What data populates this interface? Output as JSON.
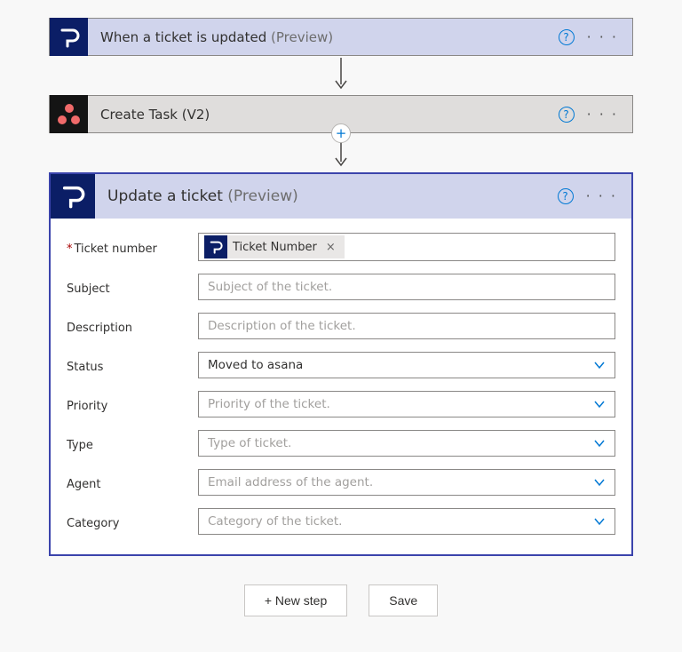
{
  "steps": {
    "trigger": {
      "title": "When a ticket is updated",
      "preview": "(Preview)"
    },
    "action1": {
      "title": "Create Task (V2)"
    },
    "selected": {
      "title": "Update a ticket",
      "preview": "(Preview)"
    }
  },
  "token": {
    "label": "Ticket Number"
  },
  "fields": {
    "ticket_number": {
      "label": "Ticket number"
    },
    "subject": {
      "label": "Subject",
      "placeholder": "Subject of the ticket."
    },
    "description": {
      "label": "Description",
      "placeholder": "Description of the ticket."
    },
    "status": {
      "label": "Status",
      "value": "Moved to asana"
    },
    "priority": {
      "label": "Priority",
      "placeholder": "Priority of the ticket."
    },
    "type": {
      "label": "Type",
      "placeholder": "Type of ticket."
    },
    "agent": {
      "label": "Agent",
      "placeholder": "Email address of the agent."
    },
    "category": {
      "label": "Category",
      "placeholder": "Category of the ticket."
    }
  },
  "buttons": {
    "new_step": "+ New step",
    "save": "Save"
  },
  "glyphs": {
    "help": "?",
    "more": "· · ·",
    "plus": "+",
    "remove": "×"
  }
}
